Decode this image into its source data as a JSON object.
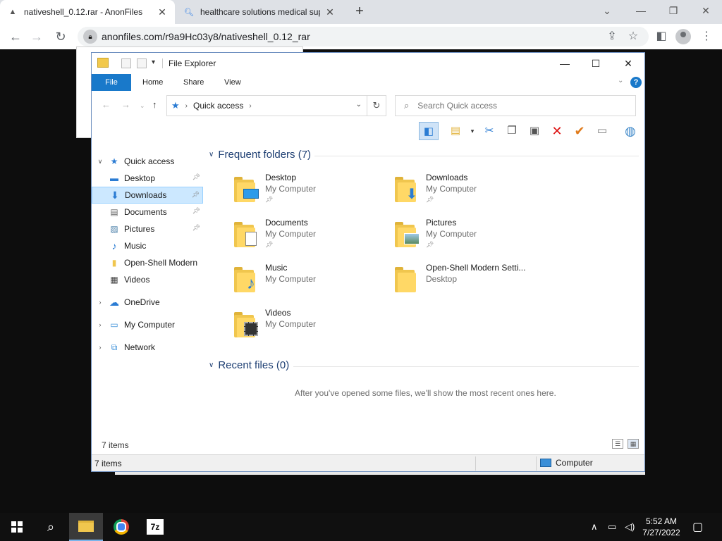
{
  "browser": {
    "tabs": [
      {
        "title": "nativeshell_0.12.rar - AnonFiles",
        "icon": "anonfiles-favicon"
      },
      {
        "title": "healthcare solutions medical sup",
        "icon": "search-favicon"
      }
    ],
    "url": "anonfiles.com/r9a9Hc03y8/nativeshell_0.12_rar"
  },
  "explorer": {
    "window_title": "File Explorer",
    "ribbon_tabs": [
      "File",
      "Home",
      "Share",
      "View"
    ],
    "address": "Quick access",
    "search_placeholder": "Search Quick access",
    "nav": {
      "quick_access": "Quick access",
      "items": [
        "Desktop",
        "Downloads",
        "Documents",
        "Pictures",
        "Music",
        "Open-Shell Modern",
        "Videos"
      ],
      "onedrive": "OneDrive",
      "my_computer": "My Computer",
      "network": "Network"
    },
    "frequent_header": "Frequent folders (7)",
    "folders": [
      {
        "name": "Desktop",
        "location": "My Computer",
        "icon": "desktop-overlay-icon"
      },
      {
        "name": "Downloads",
        "location": "My Computer",
        "icon": "download-arrow-icon"
      },
      {
        "name": "Documents",
        "location": "My Computer",
        "icon": "document-overlay-icon"
      },
      {
        "name": "Pictures",
        "location": "My Computer",
        "icon": "picture-overlay-icon"
      },
      {
        "name": "Music",
        "location": "My Computer",
        "icon": "music-note-icon"
      },
      {
        "name": "Open-Shell Modern Setti...",
        "location": "Desktop",
        "icon": "plain-folder-icon"
      },
      {
        "name": "Videos",
        "location": "My Computer",
        "icon": "film-overlay-icon"
      }
    ],
    "recent_header": "Recent files (0)",
    "recent_empty": "After you've opened some files, we'll show the most recent ones here.",
    "items_count": "7 items",
    "status_count": "7 items",
    "status_location": "Computer"
  },
  "taskbar": {
    "time": "5:52 AM",
    "date": "7/27/2022",
    "sevenzip_label": "7z"
  },
  "colors": {
    "accent": "#1979ca",
    "selection": "#cce8ff",
    "folder": "#f0c64e"
  }
}
